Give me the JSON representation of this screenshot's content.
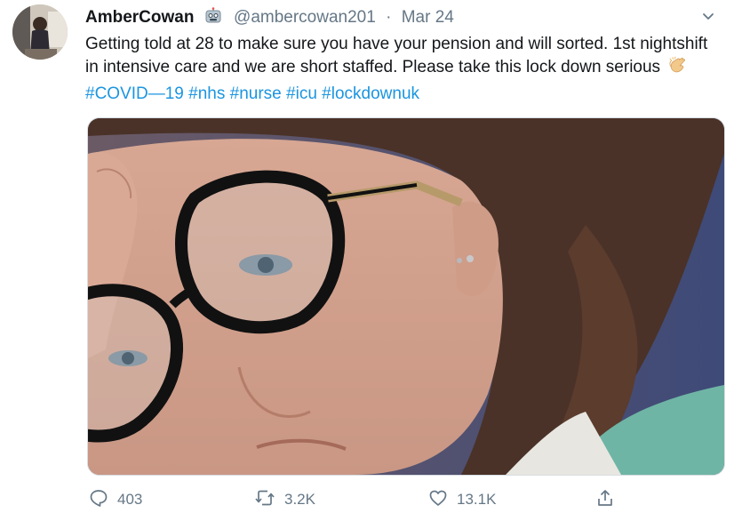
{
  "tweet": {
    "display_name": "AmberCowan",
    "badge_icon": "robot-face-icon",
    "handle": "@ambercowan201",
    "separator": "·",
    "date": "Mar 24",
    "text_main": "Getting told at 28 to make sure you have your pension and will sorted. 1st nightshift in intensive care and we are short staffed. Please take this lock down serious",
    "emoji_icon": "clapping-hands-icon",
    "hashtags": [
      "#COVID—19",
      "#nhs",
      "#nurse",
      "#icu",
      "#lockdownuk"
    ]
  },
  "actions": {
    "reply_count": "403",
    "retweet_count": "3.2K",
    "like_count": "13.1K"
  },
  "colors": {
    "link": "#1b95e0",
    "muted": "#657786",
    "text": "#14171a"
  }
}
